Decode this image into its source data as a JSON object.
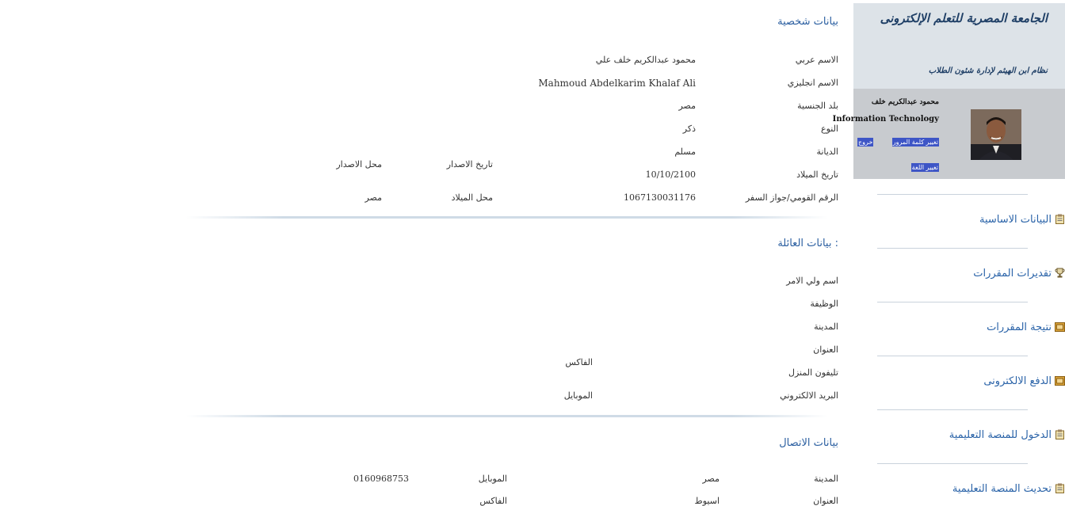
{
  "sidebar": {
    "university_title": "الجامعة المصرية للتعلم الإلكترونى",
    "system_title": "نظام ابن الهيثم لإدارة شئون الطلاب",
    "profile": {
      "name": "محمود عبدالكريم خلف",
      "department": "Information Technology",
      "change_password": "تغيير كلمة المرور",
      "logout": "خروج",
      "change_language": "تغيير اللغة"
    },
    "nav": [
      {
        "label": "البيانات الاساسية",
        "icon": "clipboard-icon"
      },
      {
        "label": "تقديرات المقررات",
        "icon": "trophy-icon"
      },
      {
        "label": "نتيجة المقررات",
        "icon": "folder-icon"
      },
      {
        "label": "الدفع الالكترونى",
        "icon": "folder-icon"
      },
      {
        "label": "الدخول للمنصة التعليمية",
        "icon": "clipboard-icon"
      },
      {
        "label": "تحديث المنصة التعليمية",
        "icon": "clipboard-icon"
      }
    ]
  },
  "personal": {
    "title": "بيانات شخصية",
    "arabic_name_label": "الاسم عربي",
    "arabic_name": "محمود عبدالكريم خلف علي",
    "english_name_label": "الاسم انجليزي",
    "english_name": "Mahmoud Abdelkarim Khalaf Ali",
    "nationality_label": "بلد الجنسية",
    "nationality": "مصر",
    "gender_label": "النوع",
    "gender": "ذكر",
    "religion_label": "الديانة",
    "religion": "مسلم",
    "birth_date_label": "تاريخ الميلاد",
    "birth_date": "10/10/2100",
    "national_id_label": "الرقم القومي/جواز السفر",
    "national_id": "1067130031176",
    "issue_date_label": "تاريخ الاصدار",
    "issue_place_label": "محل الاصدار",
    "birth_place_label": "محل الميلاد",
    "birth_place": "مصر"
  },
  "family": {
    "title": ": بيانات العائلة",
    "guardian_label": "اسم ولي الامر",
    "job_label": "الوظيفة",
    "city_label": "المدينة",
    "address_label": "العنوان",
    "home_phone_label": "تليفون المنزل",
    "email_label": "البريد الالكتروني",
    "fax_label": "الفاكس",
    "mobile_label": "الموبايل"
  },
  "contact": {
    "title": "بيانات الاتصال",
    "city_label": "المدينة",
    "city": "مصر",
    "mobile_label": "الموبايل",
    "mobile": "0160968753",
    "address_label": "العنوان",
    "address": "اسيوط",
    "fax_label": "الفاكس"
  },
  "colors": {
    "accent": "#2a5ea0",
    "sidebar_bg": "#dde3e8",
    "profile_bg": "#c8cbcf",
    "pill_bg": "#3d55c6"
  }
}
